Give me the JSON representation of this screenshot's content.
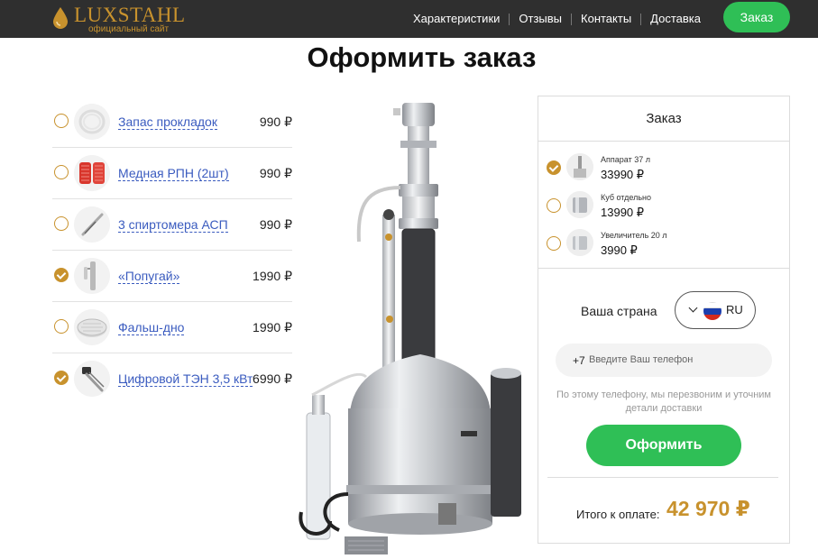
{
  "header": {
    "logo_text": "LUXSTAHL",
    "logo_subtitle": "официальный сайт",
    "nav": [
      "Характеристики",
      "Отзывы",
      "Контакты",
      "Доставка"
    ],
    "cta_label": "Заказ"
  },
  "page": {
    "title": "Оформить заказ"
  },
  "addons": [
    {
      "name": "Запас прокладок",
      "price": "990 ₽",
      "checked": false
    },
    {
      "name": "Медная РПН (2шт)",
      "price": "990 ₽",
      "checked": false
    },
    {
      "name": "3 спиртомера АСП",
      "price": "990 ₽",
      "checked": false
    },
    {
      "name": "«Попугай»",
      "price": "1990 ₽",
      "checked": true
    },
    {
      "name": "Фальш-дно",
      "price": "1990 ₽",
      "checked": false
    },
    {
      "name": "Цифровой ТЭН 3,5 кВт",
      "price": "6990 ₽",
      "checked": true
    }
  ],
  "order": {
    "title": "Заказ",
    "variants": [
      {
        "name": "Аппарат 37 л",
        "price": "33990 ₽",
        "checked": true
      },
      {
        "name": "Куб отдельно",
        "price": "13990 ₽",
        "checked": false
      },
      {
        "name": "Увеличитель 20 л",
        "price": "3990 ₽",
        "checked": false
      }
    ],
    "country_label": "Ваша страна",
    "country_code": "RU",
    "phone_prefix": "+7",
    "phone_placeholder": "Введите Ваш телефон",
    "phone_value": "",
    "hint": "По этому телефону, мы перезвоним и уточним детали доставки",
    "submit_label": "Оформить",
    "total_label": "Итого к оплате:",
    "total_value": "42 970 ₽"
  },
  "colors": {
    "accent": "#c8922d",
    "green": "#2fbf56",
    "link": "#3a5bbf",
    "header_bg": "#2f2f2f"
  }
}
